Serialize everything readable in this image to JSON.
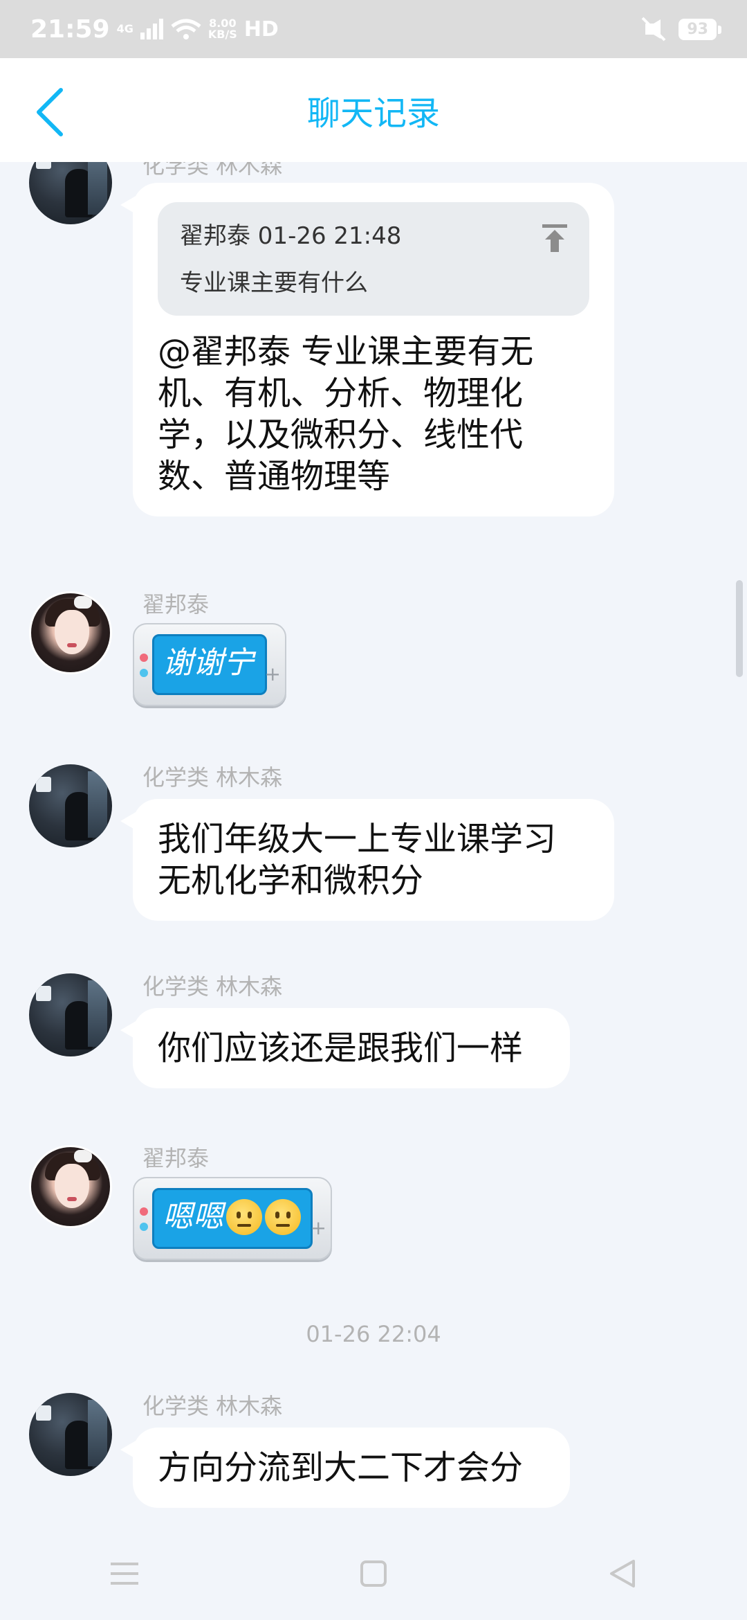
{
  "status_bar": {
    "time": "21:59",
    "network": "4G",
    "speed_value": "8.00",
    "speed_unit": "KB/S",
    "hd": "HD",
    "battery": "93"
  },
  "header": {
    "title": "聊天记录",
    "accent_color": "#12b7f5"
  },
  "messages": [
    {
      "sender": "化学类 林木森",
      "avatar": "dark-figure-avatar",
      "quote": {
        "meta": "翟邦泰 01-26 21:48",
        "text": "专业课主要有什么",
        "icon": "jump-to-top-icon"
      },
      "lines": [
        "@翟邦泰 专业课主要有无",
        "机、有机、分析、物理化",
        "学，以及微积分、线性代",
        "数、普通物理等"
      ]
    },
    {
      "sender": "翟邦泰",
      "avatar": "girl-avatar",
      "sticker_text": "谢谢宁"
    },
    {
      "sender": "化学类 林木森",
      "avatar": "dark-figure-avatar",
      "lines": [
        "我们年级大一上专业课学习",
        "无机化学和微积分"
      ]
    },
    {
      "sender": "化学类 林木森",
      "avatar": "dark-figure-avatar",
      "lines": [
        "你们应该还是跟我们一样"
      ]
    },
    {
      "sender": "翟邦泰",
      "avatar": "girl-avatar",
      "sticker_text": "嗯嗯",
      "sticker_emoji": "neutral-face-emoji"
    },
    {
      "timestamp": "01-26 22:04"
    },
    {
      "sender": "化学类 林木森",
      "avatar": "dark-figure-avatar",
      "lines": [
        "方向分流到大二下才会分"
      ]
    }
  ],
  "navbar": {
    "menu_icon": "menu-icon",
    "home_icon": "home-square-icon",
    "back_icon": "back-triangle-icon"
  }
}
